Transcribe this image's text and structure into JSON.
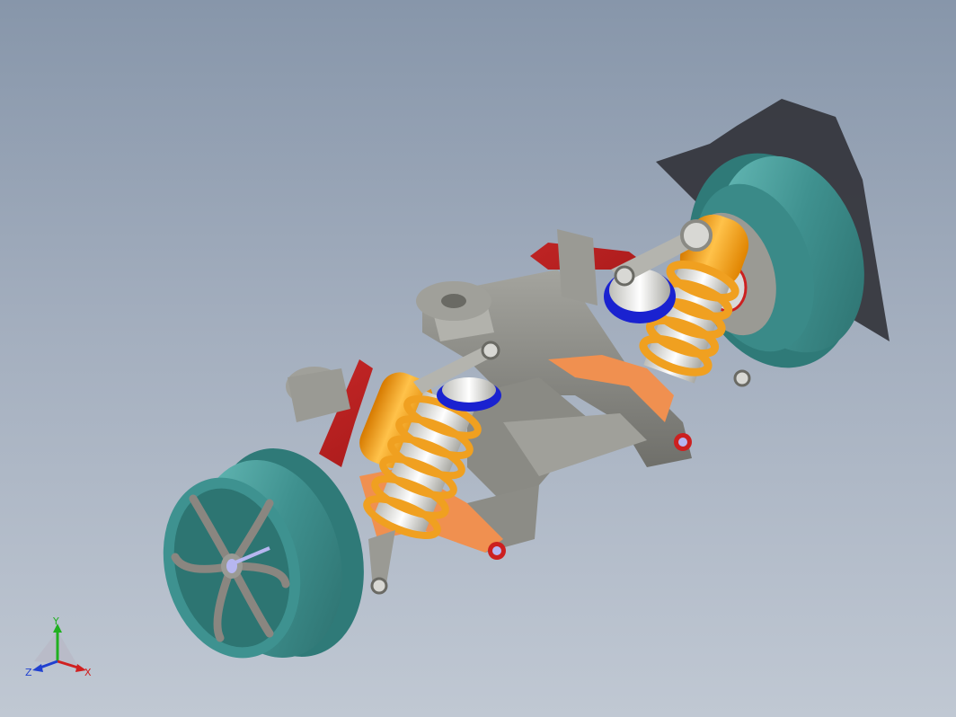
{
  "viewport": {
    "background_top": "#8796aa",
    "background_bottom": "#c0c8d3"
  },
  "model": {
    "wheel_color": "#4a9a98",
    "frame_color": "#8c8c86",
    "spring_color": "#f0a020",
    "damper_body_color": "#ef9a10",
    "control_arm_color": "#f09050",
    "stabilizer_color": "#b81414",
    "damper_seal_color": "#1a22d0"
  },
  "triad": {
    "x_label": "X",
    "y_label": "Y",
    "z_label": "Z",
    "x_color": "#d02020",
    "y_color": "#20b020",
    "z_color": "#2040d0"
  }
}
